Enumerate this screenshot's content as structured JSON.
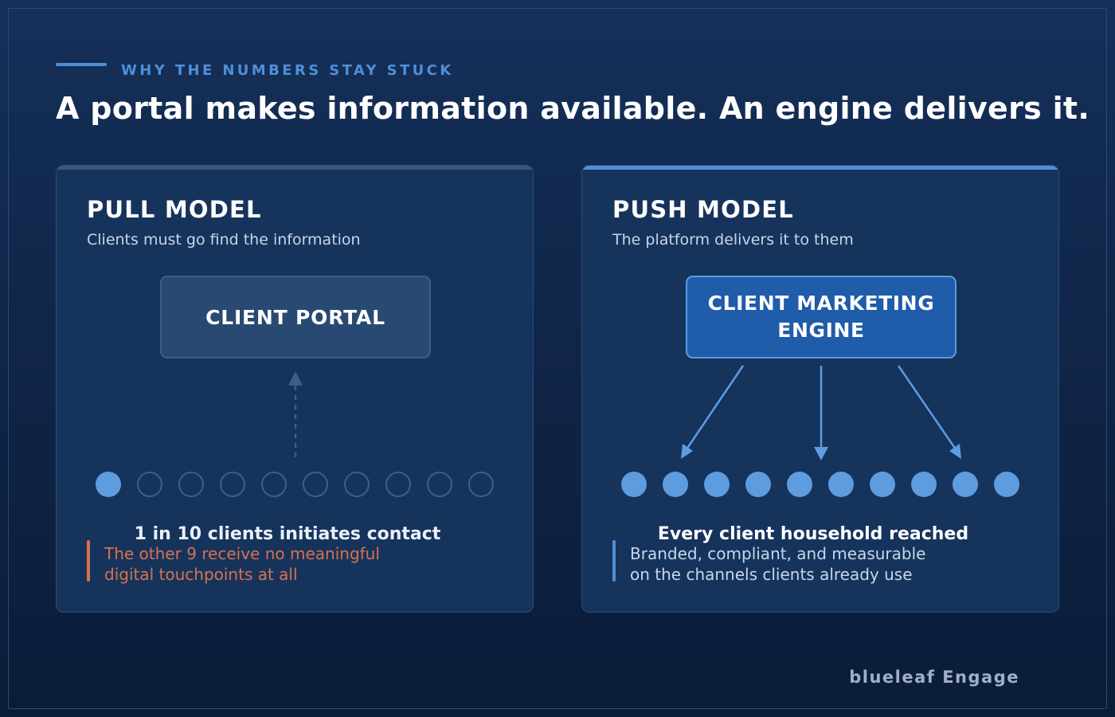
{
  "header": {
    "eyebrow": "WHY THE NUMBERS STAY STUCK",
    "headline": "A portal makes information available. An engine delivers it."
  },
  "pull": {
    "title": "PULL MODEL",
    "subtitle": "Clients must go find the information",
    "box_label": "CLIENT PORTAL",
    "clients_total": 10,
    "clients_active": 1,
    "callout_title": "1 in 10 clients initiates contact",
    "callout_line1": "The other 9 receive no meaningful",
    "callout_line2": "digital touchpoints at all"
  },
  "push": {
    "title": "PUSH MODEL",
    "subtitle": "The platform delivers it to them",
    "box_label_line1": "CLIENT MARKETING",
    "box_label_line2": "ENGINE",
    "clients_total": 10,
    "clients_active": 10,
    "callout_title": "Every client household reached",
    "callout_line1": "Branded, compliant, and measurable",
    "callout_line2": "on the channels clients already use"
  },
  "footer": {
    "brand": "blueleaf Engage"
  },
  "colors": {
    "accent": "#4f8fd6",
    "warning": "#d8724e",
    "dot_filled": "#5e9ce0",
    "dot_empty": "#3d5e88"
  }
}
